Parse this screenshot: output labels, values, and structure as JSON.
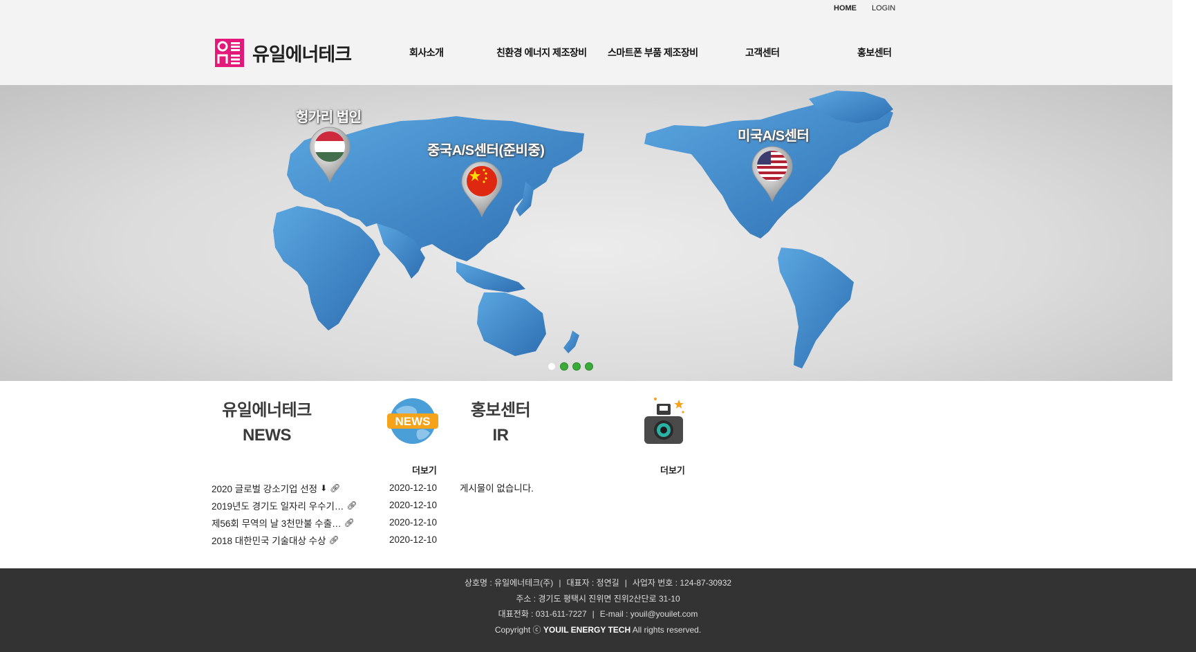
{
  "header": {
    "top_links": {
      "home": "HOME",
      "login": "LOGIN"
    },
    "logo_text": "유일에너테크",
    "nav": [
      "회사소개",
      "친환경 에너지 제조장비",
      "스마트폰 부품 제조장비",
      "고객센터",
      "홍보센터"
    ]
  },
  "banner": {
    "pins": [
      {
        "label": "헝가리 법인",
        "flag": "hungary-flag-icon"
      },
      {
        "label": "중국A/S센터(준비중)",
        "flag": "china-flag-icon"
      },
      {
        "label": "미국A/S센터",
        "flag": "usa-flag-icon"
      }
    ],
    "slide_count": 4,
    "active_slide": 1
  },
  "news_section": {
    "title_line1": "유일에너테크",
    "title_line2": "NEWS",
    "icon": "news-globe-icon",
    "icon_text": "NEWS",
    "more": "더보기",
    "items": [
      {
        "title": "2020 글로벌 강소기업 선정",
        "date": "2020-12-10",
        "icons": [
          "download-icon",
          "link-icon"
        ]
      },
      {
        "title": "2019년도 경기도 일자리 우수기…",
        "date": "2020-12-10",
        "icons": [
          "link-icon"
        ]
      },
      {
        "title": "제56회 무역의 날 3천만불 수출…",
        "date": "2020-12-10",
        "icons": [
          "link-icon"
        ]
      },
      {
        "title": "2018 대한민국 기술대상 수상",
        "date": "2020-12-10",
        "icons": [
          "link-icon"
        ]
      }
    ]
  },
  "pr_section": {
    "title_line1": "홍보센터",
    "title_line2": "IR",
    "icon": "camera-icon",
    "more": "더보기",
    "empty_message": "게시물이 없습니다."
  },
  "footer": {
    "company": "상호명 : 유일에너테크(주)",
    "ceo": "대표자 : 정연길",
    "biz_no": "사업자 번호 : 124-87-30932",
    "address": "주소 : 경기도 평택시 진위면 진위2산단로 31-10",
    "phone": "대표전화 : 031-611-7227",
    "email": "E-mail : youil@youilet.com",
    "copyright_prefix": "Copyright ⓒ",
    "copyright_brand": "YOUIL ENERGY TECH",
    "copyright_suffix": "All rights reserved.",
    "separator": "|"
  },
  "colors": {
    "brand_pink": "#e4177a",
    "map_blue": "#3f86c9",
    "dot_green": "#3aaa3a",
    "footer_bg": "#333333"
  }
}
